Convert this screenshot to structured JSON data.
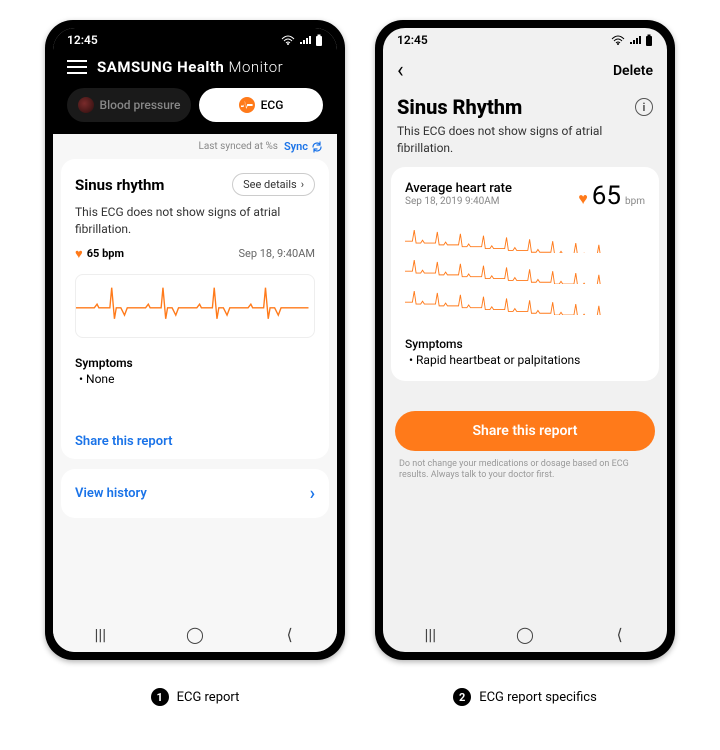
{
  "status_time": "12:45",
  "phone_a": {
    "app_title_bold": "SAMSUNG",
    "app_title_mid": "Health",
    "app_title_thin": "Monitor",
    "tab_bp": "Blood pressure",
    "tab_ecg": "ECG",
    "last_synced": "Last synced at %s",
    "sync_label": "Sync",
    "result_title": "Sinus rhythm",
    "see_details": "See details",
    "result_desc": "This ECG does not show signs of atrial fibrillation.",
    "bpm": "65 bpm",
    "timestamp": "Sep 18, 9:40AM",
    "symptoms_label": "Symptoms",
    "symptoms_value": "None",
    "share": "Share this report",
    "view_history": "View history",
    "accent_link": "#1a73e8",
    "ecg_orange": "#ff7a1a"
  },
  "phone_b": {
    "delete_label": "Delete",
    "title": "Sinus Rhythm",
    "desc": "This ECG does not show signs of atrial fibrillation.",
    "ahr_label": "Average heart rate",
    "ahr_timestamp": "Sep 18, 2019 9:40AM",
    "ahr_value": "65",
    "ahr_unit": "bpm",
    "symptoms_label": "Symptoms",
    "symptoms_value": "Rapid heartbeat or palpitations",
    "share": "Share this report",
    "disclaimer": "Do not change your medications or dosage based on ECG results. Always talk to your doctor first."
  },
  "captions": {
    "a_num": "1",
    "a_text": "ECG report",
    "b_num": "2",
    "b_text": "ECG report specifics"
  }
}
